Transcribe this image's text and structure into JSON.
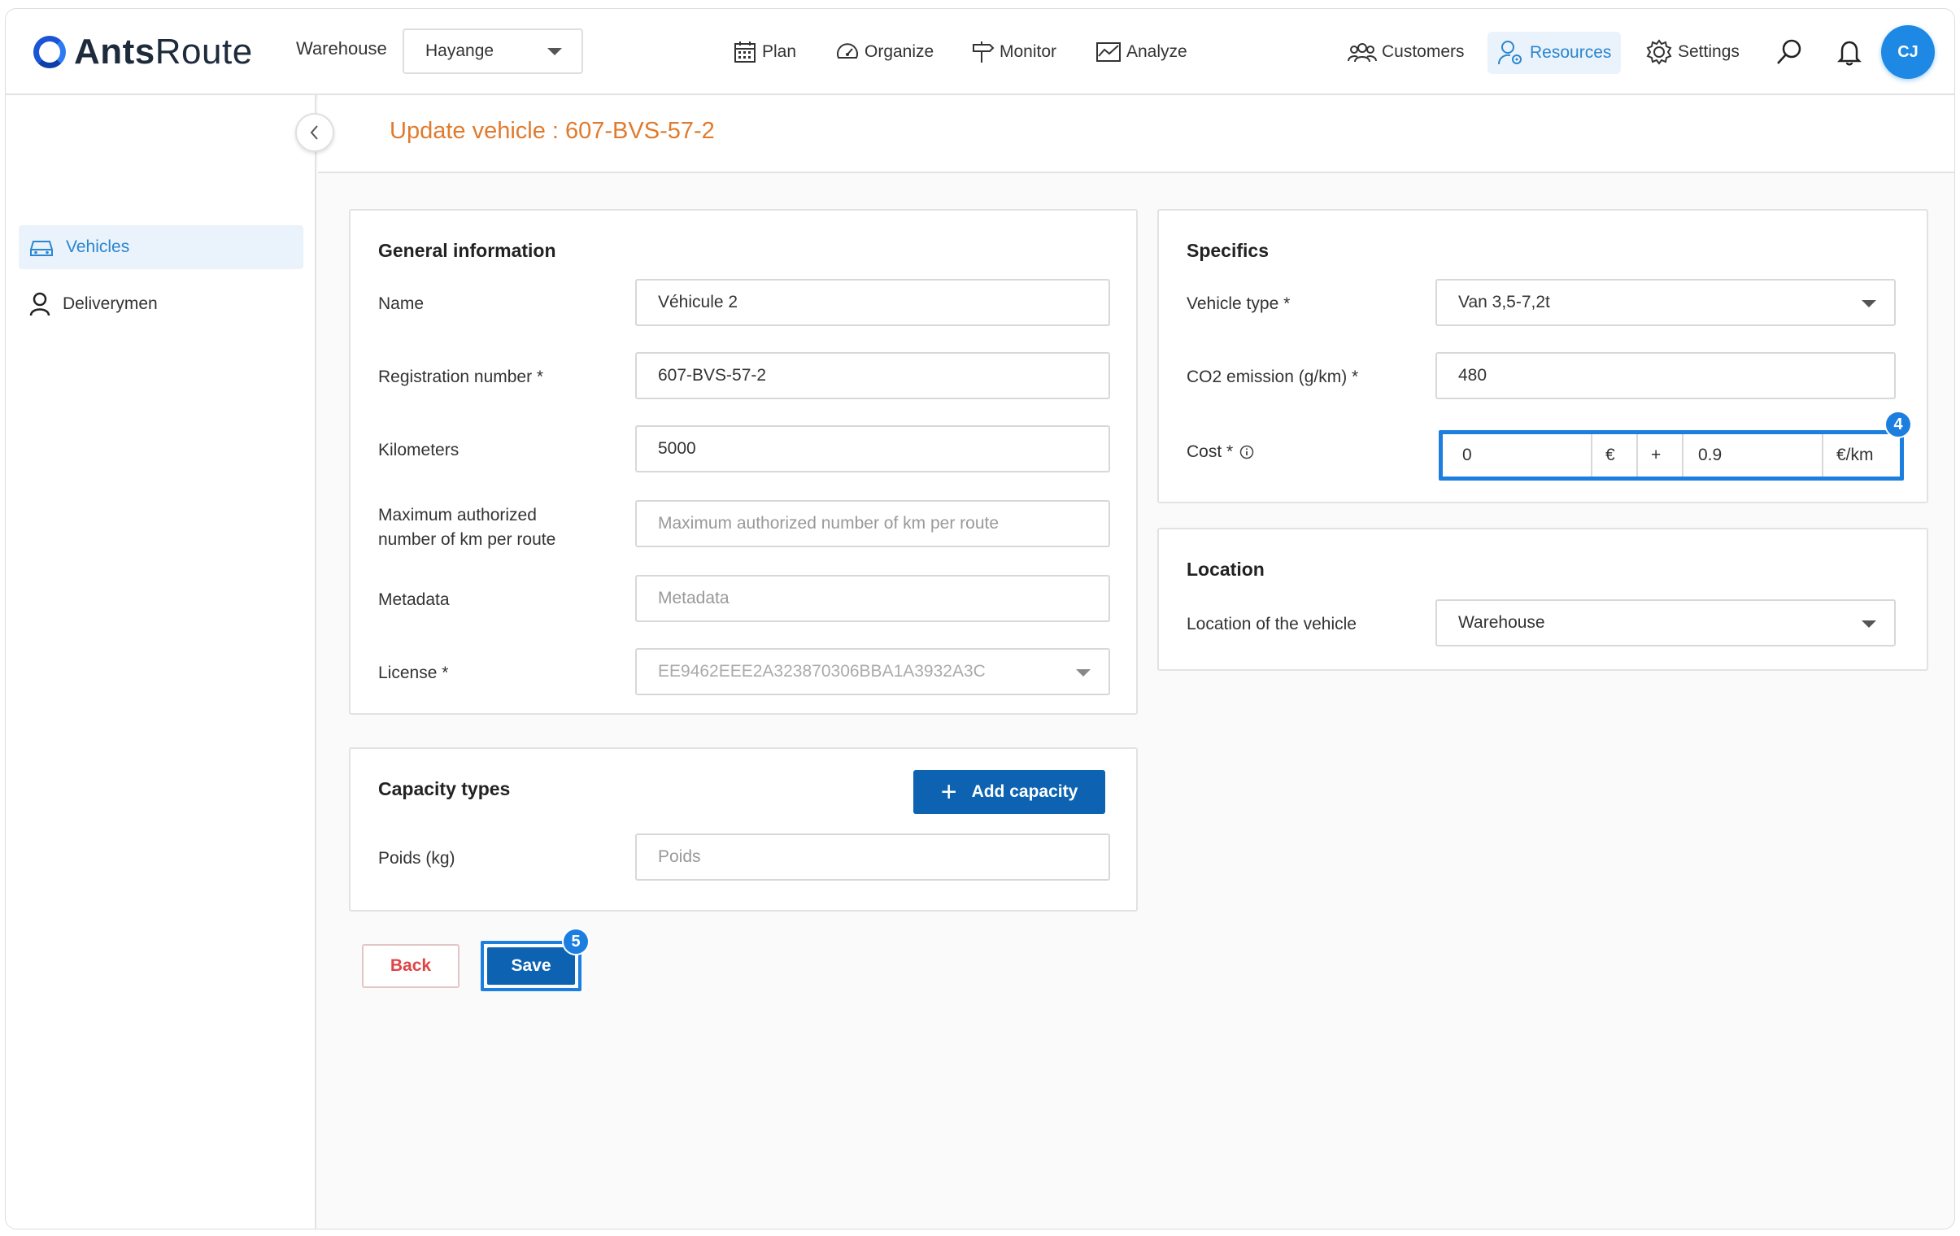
{
  "app": {
    "logo_bold": "Ants",
    "logo_light": "Route"
  },
  "topbar": {
    "warehouse_label": "Warehouse",
    "warehouse_value": "Hayange",
    "nav": {
      "plan": "Plan",
      "organize": "Organize",
      "monitor": "Monitor",
      "analyze": "Analyze"
    },
    "right": {
      "customers": "Customers",
      "resources": "Resources",
      "settings": "Settings"
    },
    "avatar_initials": "CJ"
  },
  "sidebar": {
    "vehicles": "Vehicles",
    "deliverymen": "Deliverymen"
  },
  "page": {
    "title": "Update vehicle : 607-BVS-57-2"
  },
  "general": {
    "title": "General information",
    "name_label": "Name",
    "name_value": "Véhicule 2",
    "reg_label": "Registration number *",
    "reg_value": "607-BVS-57-2",
    "km_label": "Kilometers",
    "km_value": "5000",
    "max_km_label_1": "Maximum authorized",
    "max_km_label_2": "number of km per route",
    "max_km_placeholder": "Maximum authorized number of km per route",
    "metadata_label": "Metadata",
    "metadata_placeholder": "Metadata",
    "license_label": "License *",
    "license_value": "EE9462EEE2A323870306BBA1A3932A3C"
  },
  "capacity": {
    "title": "Capacity types",
    "add_label": "Add capacity",
    "poids_label": "Poids (kg)",
    "poids_placeholder": "Poids"
  },
  "specifics": {
    "title": "Specifics",
    "vtype_label": "Vehicle type *",
    "vtype_value": "Van 3,5-7,2t",
    "co2_label": "CO2 emission (g/km) *",
    "co2_value": "480",
    "cost_label": "Cost *",
    "cost_fixed": "0",
    "cost_fixed_unit": "€",
    "cost_plus": "+",
    "cost_km": "0.9",
    "cost_km_unit": "€/km",
    "badge": "4"
  },
  "location": {
    "title": "Location",
    "label": "Location of the vehicle",
    "value": "Warehouse"
  },
  "actions": {
    "back": "Back",
    "save": "Save",
    "save_badge": "5"
  },
  "colors": {
    "accent": "#1c7fe0",
    "primary_button": "#0d63b1",
    "title_orange": "#e07b2e",
    "back_red": "#e04545"
  }
}
